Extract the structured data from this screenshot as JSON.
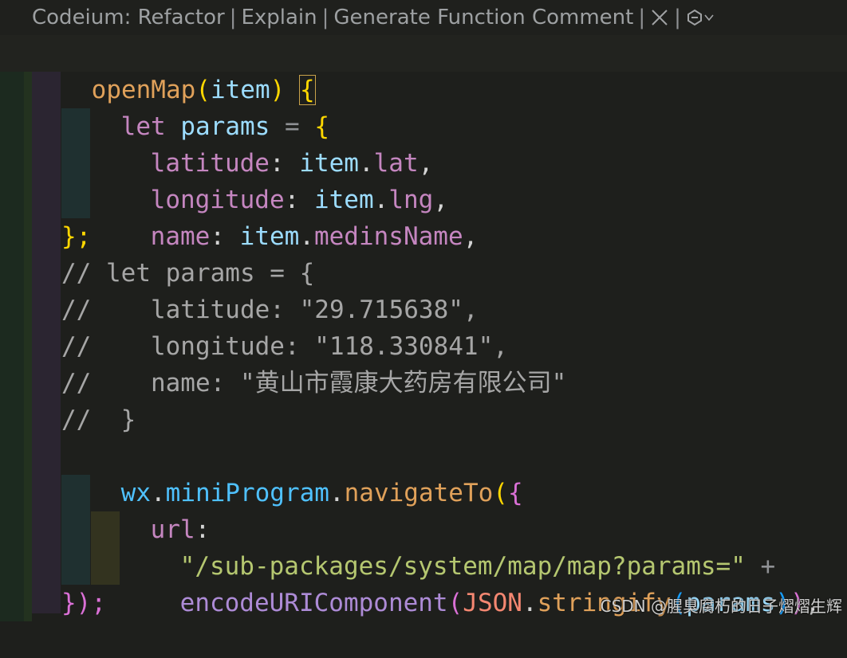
{
  "codelens": {
    "refactor": "Codeium: Refactor",
    "explain": "Explain",
    "generate": "Generate Function Comment",
    "separator": "|",
    "close_icon": "close-icon",
    "codeium_icon": "codeium-logo-icon",
    "chevron_icon": "chevron-down-icon"
  },
  "code": {
    "l1": {
      "fn": "openMap",
      "p1": "(",
      "arg": "item",
      "p2": ")",
      "sp": " ",
      "brace": "{"
    },
    "l2": {
      "kw": "let",
      "name": "params",
      "eq": "=",
      "brace": "{"
    },
    "l3": {
      "key": "latitude",
      "colon": ":",
      "obj": "item",
      "dot": ".",
      "prop": "lat",
      "comma": ","
    },
    "l4": {
      "key": "longitude",
      "colon": ":",
      "obj": "item",
      "dot": ".",
      "prop": "lng",
      "comma": ","
    },
    "l5": {
      "key": "name",
      "colon": ":",
      "obj": "item",
      "dot": ".",
      "prop": "medinsName",
      "comma": ","
    },
    "l6": {
      "text": "};"
    },
    "l7": {
      "text": "// let params = {"
    },
    "l8": {
      "text": "//    latitude: \"29.715638\","
    },
    "l9": {
      "text": "//    longitude: \"118.330841\","
    },
    "l10": {
      "text": "//    name: \"黄山市霞康大药房有限公司\""
    },
    "l11": {
      "text": "//  }"
    },
    "l12": {
      "obj": "wx",
      "dot1": ".",
      "obj2": "miniProgram",
      "dot2": ".",
      "fn": "navigateTo",
      "p1": "(",
      "brace": "{"
    },
    "l13": {
      "key": "url",
      "colon": ":"
    },
    "l14": {
      "str": "\"/sub-packages/system/map/map?params=\"",
      "plus": "+"
    },
    "l15": {
      "fn": "encodeURIComponent",
      "p1": "(",
      "json": "JSON",
      "dot": ".",
      "fn2": "stringify",
      "p2": "(",
      "arg": "params",
      "p3": ")",
      "p4": ")",
      "comma": ","
    },
    "l16": {
      "text": "});"
    }
  },
  "watermark": "CSDN @腥臭腐朽的日子熠熠生辉"
}
